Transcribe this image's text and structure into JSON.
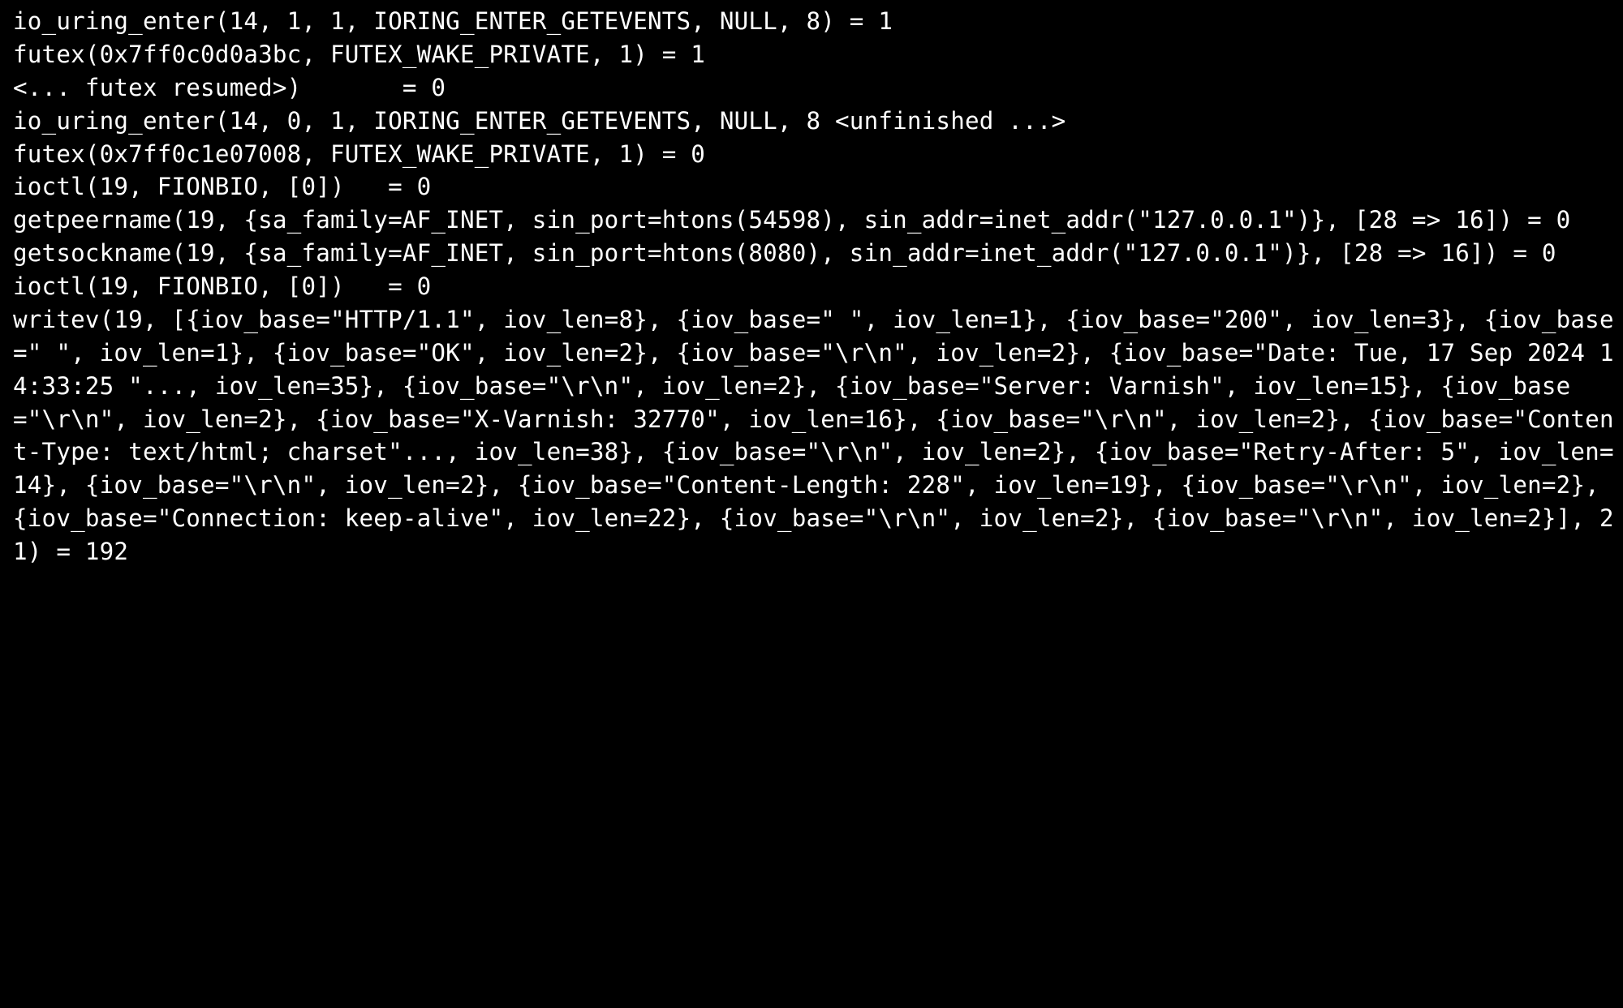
{
  "terminal": {
    "lines": [
      "io_uring_enter(14, 1, 1, IORING_ENTER_GETEVENTS, NULL, 8) = 1",
      "futex(0x7ff0c0d0a3bc, FUTEX_WAKE_PRIVATE, 1) = 1",
      "<... futex resumed>)       = 0",
      "io_uring_enter(14, 0, 1, IORING_ENTER_GETEVENTS, NULL, 8 <unfinished ...>",
      "futex(0x7ff0c1e07008, FUTEX_WAKE_PRIVATE, 1) = 0",
      "ioctl(19, FIONBIO, [0])   = 0",
      "getpeername(19, {sa_family=AF_INET, sin_port=htons(54598), sin_addr=inet_addr(\"127.0.0.1\")}, [28 => 16]) = 0",
      "getsockname(19, {sa_family=AF_INET, sin_port=htons(8080), sin_addr=inet_addr(\"127.0.0.1\")}, [28 => 16]) = 0",
      "ioctl(19, FIONBIO, [0])   = 0",
      "writev(19, [{iov_base=\"HTTP/1.1\", iov_len=8}, {iov_base=\" \", iov_len=1}, {iov_base=\"200\", iov_len=3}, {iov_base=\" \", iov_len=1}, {iov_base=\"OK\", iov_len=2}, {iov_base=\"\\r\\n\", iov_len=2}, {iov_base=\"Date: Tue, 17 Sep 2024 14:33:25 \"..., iov_len=35}, {iov_base=\"\\r\\n\", iov_len=2}, {iov_base=\"Server: Varnish\", iov_len=15}, {iov_base=\"\\r\\n\", iov_len=2}, {iov_base=\"X-Varnish: 32770\", iov_len=16}, {iov_base=\"\\r\\n\", iov_len=2}, {iov_base=\"Content-Type: text/html; charset\"..., iov_len=38}, {iov_base=\"\\r\\n\", iov_len=2}, {iov_base=\"Retry-After: 5\", iov_len=14}, {iov_base=\"\\r\\n\", iov_len=2}, {iov_base=\"Content-Length: 228\", iov_len=19}, {iov_base=\"\\r\\n\", iov_len=2}, {iov_base=\"Connection: keep-alive\", iov_len=22}, {iov_base=\"\\r\\n\", iov_len=2}, {iov_base=\"\\r\\n\", iov_len=2}], 21) = 192"
    ]
  }
}
